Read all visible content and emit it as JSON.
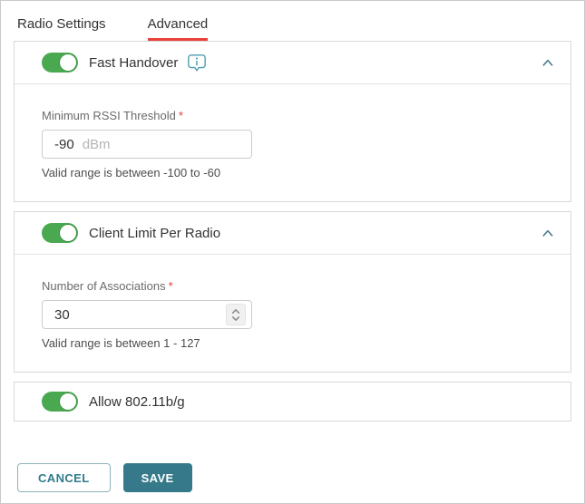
{
  "colors": {
    "toggle_green": "#4aa950",
    "accent_teal": "#35798a",
    "tab_underline_red": "#e8413c",
    "required_red": "#e53935"
  },
  "tabs": [
    {
      "label": "Radio Settings",
      "active": false
    },
    {
      "label": "Advanced",
      "active": true
    }
  ],
  "sections": [
    {
      "toggle_label": "Fast Handover",
      "toggle_state": "on",
      "icons": {
        "info": "info-tooltip-icon",
        "collapse": "chevron-up-icon"
      },
      "field": {
        "label": "Minimum RSSI Threshold",
        "required_marker": "*",
        "value": "-90",
        "suffix": "dBm",
        "helper": "Valid range is between -100 to -60"
      }
    },
    {
      "toggle_label": "Client Limit Per Radio",
      "toggle_state": "on",
      "icons": {
        "collapse": "chevron-up-icon",
        "stepper": "number-stepper-icon"
      },
      "field": {
        "label": "Number of Associations",
        "required_marker": "*",
        "value": "30",
        "helper": "Valid range is between 1 - 127"
      }
    },
    {
      "toggle_label": "Allow 802.11b/g",
      "toggle_state": "on"
    }
  ],
  "footer": {
    "cancel_label": "CANCEL",
    "save_label": "SAVE"
  }
}
